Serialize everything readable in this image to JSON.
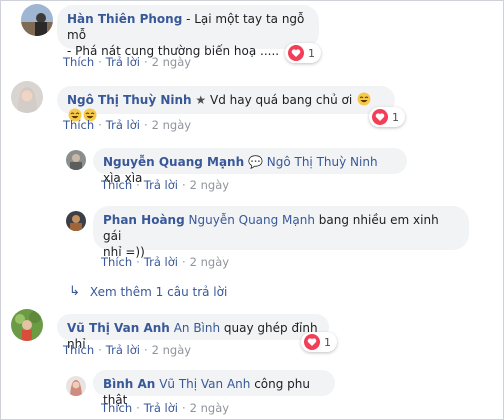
{
  "comments": [
    {
      "name": "Hàn Thiên Phong",
      "text": " - Lại một tay ta ngỗ mỗ",
      "text2": "- Phá nát cung thường biến hoạ .....",
      "reaction_count": "1",
      "like": "Thích",
      "reply": "Trả lời",
      "time": "2 ngày"
    },
    {
      "name": "Ngô Thị Thuỳ Ninh",
      "text": " Vd hay quá bang chủ ơi ",
      "reaction_count": "1",
      "like": "Thích",
      "reply": "Trả lời",
      "time": "2 ngày",
      "replies": [
        {
          "name": "Nguyễn Quang Mạnh",
          "tag": "Ngô Thị Thuỳ Ninh",
          "text": " xìa xìa",
          "like": "Thích",
          "reply": "Trả lời",
          "time": "2 ngày"
        },
        {
          "name": "Phan Hoàng",
          "tag": "Nguyễn Quang Mạnh",
          "text": " bang nhiều em xinh gái",
          "text2": "nhỉ =))",
          "like": "Thích",
          "reply": "Trả lời",
          "time": "2 ngày"
        }
      ],
      "more_replies": "Xem thêm 1 câu trả lời"
    },
    {
      "name": "Vũ Thị Van Anh",
      "tag": "An Bình",
      "text": " quay ghép đỉnh nhỉ",
      "reaction_count": "1",
      "like": "Thích",
      "reply": "Trả lời",
      "time": "2 ngày",
      "replies": [
        {
          "name": "Bình An",
          "tag": "Vũ Thị Van Anh",
          "text": " công phu thật",
          "like": "Thích",
          "reply": "Trả lời",
          "time": "2 ngày"
        }
      ]
    }
  ],
  "colors": {
    "link": "#385898",
    "bubble": "#f2f3f5",
    "heart": "#f33e58",
    "muted": "#90949c"
  }
}
